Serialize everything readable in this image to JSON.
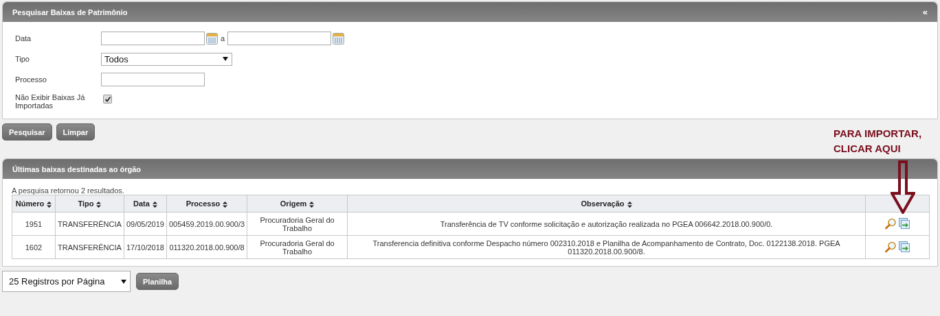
{
  "search_panel": {
    "title": "Pesquisar Baixas de Patrimônio",
    "collapse": "«",
    "fields": [
      {
        "kind": "daterange",
        "label": "Data",
        "separator": "a"
      },
      {
        "kind": "select",
        "label": "Tipo",
        "value": "Todos"
      },
      {
        "kind": "text",
        "label": "Processo"
      },
      {
        "kind": "checkbox",
        "label": "Não Exibir Baixas Já Importadas",
        "checked": true
      }
    ],
    "buttons": [
      "Pesquisar",
      "Limpar"
    ]
  },
  "annotation": {
    "text": "PARA IMPORTAR, CLICAR AQUI"
  },
  "results_panel": {
    "title": "Últimas baixas destinadas ao órgão",
    "summary": "A pesquisa retornou 2 resultados.",
    "columns": [
      "Número",
      "Tipo",
      "Data",
      "Processo",
      "Origem",
      "Observação",
      ""
    ],
    "rows": [
      {
        "cells": [
          "1951",
          "TRANSFERÊNCIA",
          "09/05/2019",
          "005459.2019.00.900/3",
          "Procuradoria Geral do Trabalho",
          "Transferência de TV conforme solicitação e autorização realizada no PGEA 006642.2018.00.900/0."
        ]
      },
      {
        "cells": [
          "1602",
          "TRANSFERÊNCIA",
          "17/10/2018",
          "011320.2018.00.900/8",
          "Procuradoria Geral do Trabalho",
          "Transferencia definitiva conforme Despacho número 002310.2018 e Planilha de Acompanhamento de Contrato, Doc. 0122138.2018. PGEA 011320.2018.00.900/8."
        ]
      }
    ]
  },
  "footer": {
    "page_size": "25 Registros por Página",
    "button": "Planilha"
  }
}
